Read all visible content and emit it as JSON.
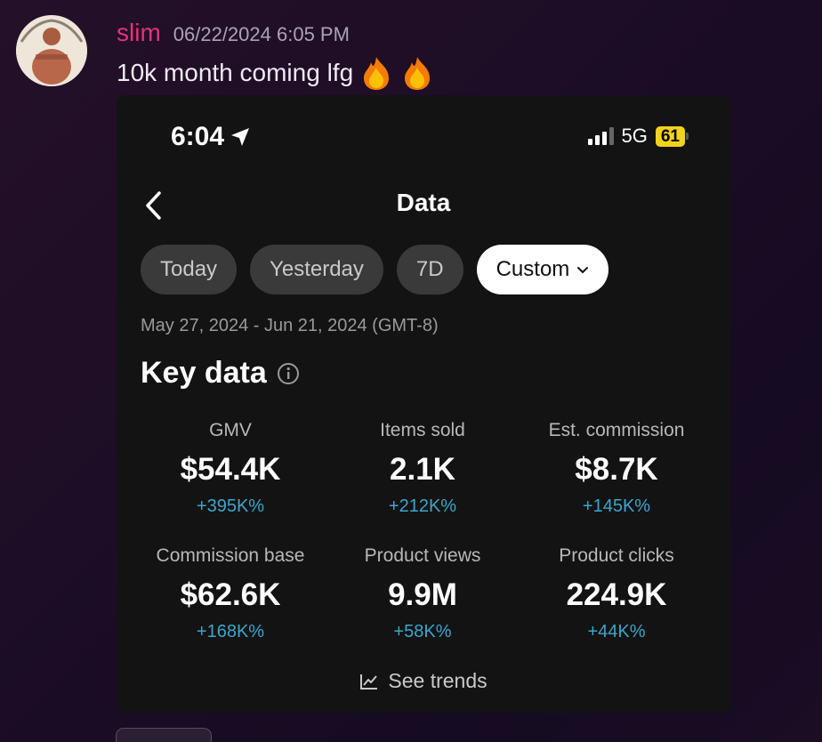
{
  "message": {
    "username": "slim",
    "timestamp": "06/22/2024 6:05 PM",
    "text": "10k month coming lfg",
    "emojis": [
      "fire-emoji",
      "fire-emoji"
    ]
  },
  "phone": {
    "time": "6:04",
    "network": "5G",
    "battery": "61"
  },
  "page": {
    "title": "Data",
    "tabs": [
      {
        "label": "Today"
      },
      {
        "label": "Yesterday"
      },
      {
        "label": "7D"
      },
      {
        "label": "Custom"
      }
    ],
    "date_range": "May 27, 2024 - Jun 21, 2024 (GMT-8)",
    "section_title": "Key data",
    "metrics": [
      {
        "label": "GMV",
        "value": "$54.4K",
        "change": "+395K%"
      },
      {
        "label": "Items sold",
        "value": "2.1K",
        "change": "+212K%"
      },
      {
        "label": "Est. commission",
        "value": "$8.7K",
        "change": "+145K%"
      },
      {
        "label": "Commission base",
        "value": "$62.6K",
        "change": "+168K%"
      },
      {
        "label": "Product views",
        "value": "9.9M",
        "change": "+58K%"
      },
      {
        "label": "Product clicks",
        "value": "224.9K",
        "change": "+44K%"
      }
    ],
    "see_trends": "See trends"
  },
  "colors": {
    "username": "#e2337a",
    "change": "#3aa7cc",
    "battery": "#f1d31d"
  }
}
